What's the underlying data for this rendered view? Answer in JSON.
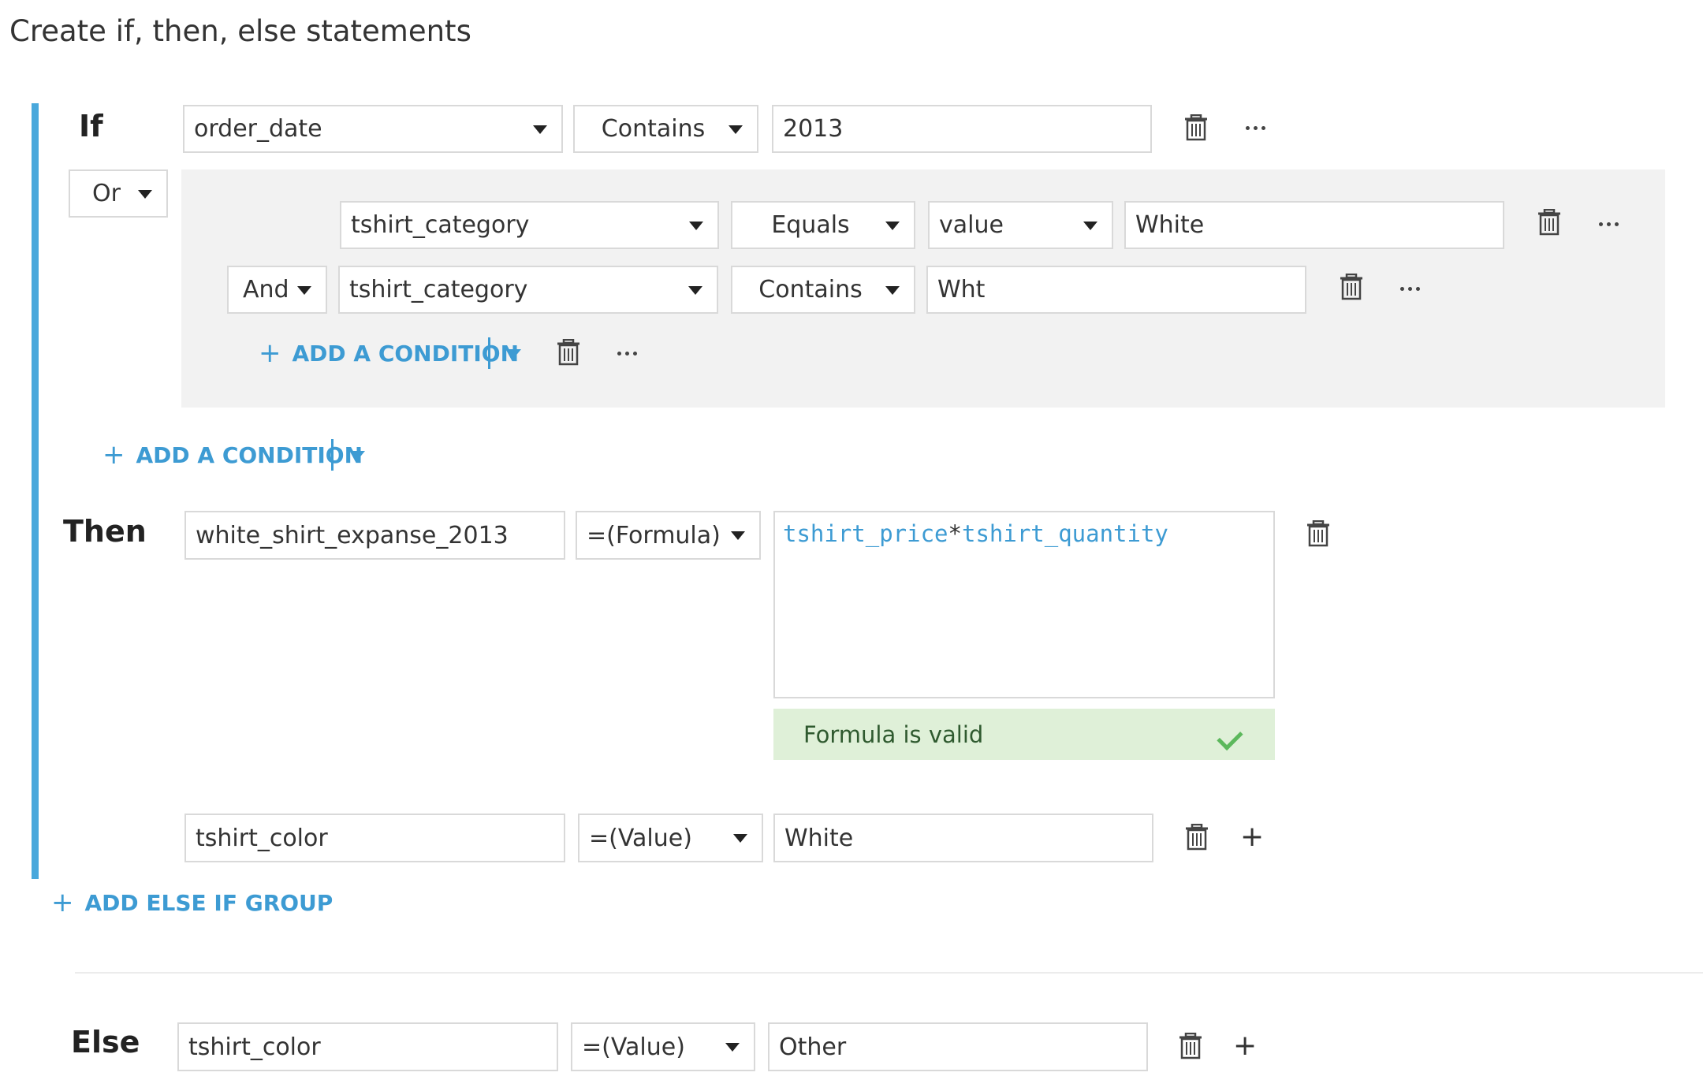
{
  "page": {
    "title": "Create if, then, else statements"
  },
  "if_group": {
    "label": "If",
    "main_condition": {
      "column": "order_date",
      "operator": "Contains",
      "value": "2013"
    },
    "logic_operator": "Or",
    "subgroup": {
      "condition1": {
        "column": "tshirt_category",
        "operator": "Equals",
        "value_type": "value",
        "value": "White"
      },
      "condition2": {
        "logic_operator": "And",
        "column": "tshirt_category",
        "operator": "Contains",
        "value": "Wht"
      },
      "add_condition_label": "ADD A CONDITION"
    },
    "add_condition_label": "ADD A CONDITION"
  },
  "then_group": {
    "label": "Then",
    "action1": {
      "column": "white_shirt_expanse_2013",
      "mode": "=(Formula)",
      "formula_tokens": {
        "a": "tshirt_price",
        "op": "*",
        "b": "tshirt_quantity"
      },
      "validation_message": "Formula is valid"
    },
    "action2": {
      "column": "tshirt_color",
      "mode": "=(Value)",
      "value": "White"
    }
  },
  "add_else_if_label": "ADD ELSE IF GROUP",
  "else_group": {
    "label": "Else",
    "column": "tshirt_color",
    "mode": "=(Value)",
    "value": "Other"
  },
  "colors": {
    "accent_blue": "#3d9bd3",
    "left_bar": "#49a8dc",
    "panel_gray": "#f2f2f2",
    "valid_green_bg": "#dff0d8",
    "valid_check": "#5cb85c"
  }
}
